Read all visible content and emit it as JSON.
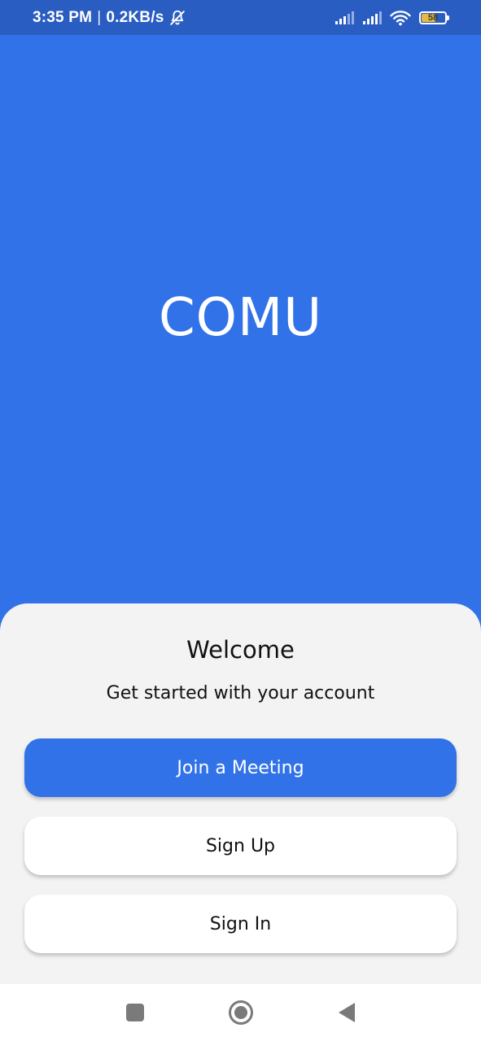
{
  "status_bar": {
    "time": "3:35 PM",
    "separator": "|",
    "network_speed": "0.2KB/s",
    "battery_level": "58",
    "battery_fraction": 0.58,
    "icons": [
      "bell-off-icon",
      "cell-signal-icon",
      "cell-signal-icon",
      "wifi-icon",
      "battery-icon"
    ]
  },
  "hero": {
    "app_name": "COMU"
  },
  "welcome": {
    "title": "Welcome",
    "subtitle": "Get started with your account"
  },
  "actions": {
    "join_label": "Join a Meeting",
    "signup_label": "Sign Up",
    "signin_label": "Sign In"
  },
  "navigation": {
    "icons": [
      "recent-apps-icon",
      "home-icon",
      "back-icon"
    ]
  },
  "colors": {
    "primary": "#3172e8",
    "status_bar": "#2a5dc2",
    "sheet": "#f3f3f3",
    "button_secondary": "#ffffff"
  }
}
